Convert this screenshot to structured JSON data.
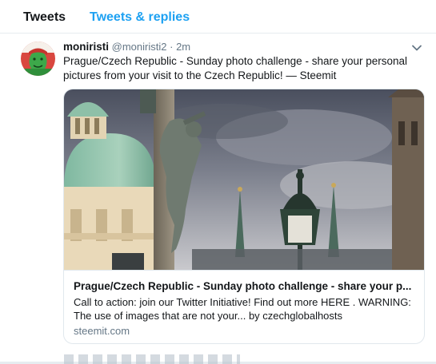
{
  "tabs": [
    {
      "label": "Tweets",
      "active": true
    },
    {
      "label": "Tweets & replies",
      "active": false
    }
  ],
  "tweet": {
    "fullname": "moniristi",
    "screenname": "@moniristi2",
    "separator": "·",
    "time": "2m",
    "text": "Prague/Czech Republic - Sunday photo challenge - share your personal pictures from your visit to the Czech Republic! — Steemit",
    "card": {
      "title": "Prague/Czech Republic - Sunday photo challenge - share your p...",
      "description": "Call to action: join our Twitter Initiative! Find out more HERE . WARNING: The use of images that are not your... by czechglobalhosts",
      "domain": "steemit.com"
    }
  },
  "colors": {
    "accent": "#1da1f2",
    "muted": "#657786",
    "border": "#e1e8ed"
  },
  "icons": [
    "chevron-down-icon"
  ]
}
